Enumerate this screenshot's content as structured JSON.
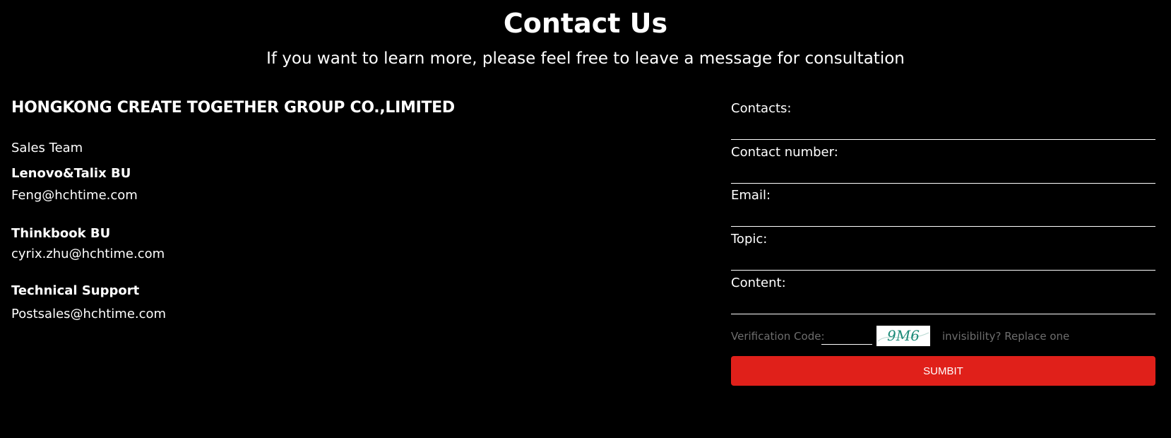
{
  "header": {
    "title": "Contact Us",
    "subtitle": "If you want to learn more, please feel free to leave a message for consultation"
  },
  "company": {
    "name": "HONGKONG CREATE TOGETHER GROUP CO.,LIMITED",
    "team_label": "Sales Team",
    "units": [
      {
        "name": "Lenovo&Talix  BU",
        "email": "Feng@hchtime.com"
      },
      {
        "name": "Thinkbook BU",
        "email": "cyrix.zhu@hchtime.com"
      },
      {
        "name": "Technical Support",
        "email": "Postsales@hchtime.com"
      }
    ]
  },
  "form": {
    "fields": [
      {
        "label": "Contacts:",
        "value": ""
      },
      {
        "label": "Contact number:",
        "value": ""
      },
      {
        "label": "Email:",
        "value": ""
      },
      {
        "label": "Topic:",
        "value": ""
      },
      {
        "label": "Content:",
        "value": ""
      }
    ],
    "verification_label": "Verification Code:",
    "verification_value": "",
    "captcha_text": "9M6",
    "replace_link": "invisibility? Replace one",
    "submit_label": "SUMBIT"
  },
  "colors": {
    "background": "#000000",
    "text": "#ffffff",
    "muted_text": "#6e6e6e",
    "accent": "#e0201a",
    "captcha_ink": "#1c8a78"
  }
}
